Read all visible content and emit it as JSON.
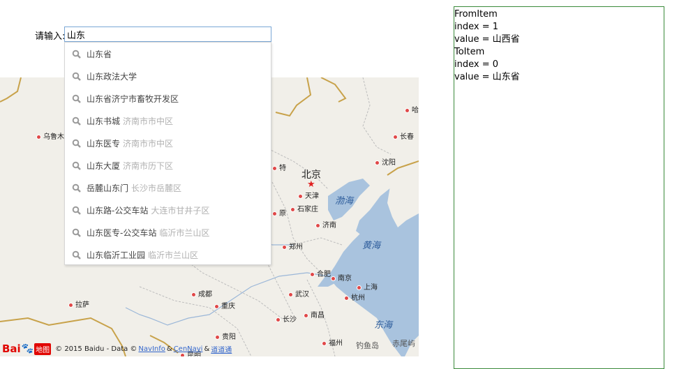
{
  "search": {
    "label": "请输入:",
    "value": "山东"
  },
  "suggestions": [
    {
      "main": "山东省",
      "sub": ""
    },
    {
      "main": "山东政法大学",
      "sub": ""
    },
    {
      "main": "山东省济宁市畜牧开发区",
      "sub": ""
    },
    {
      "main": "山东书城",
      "sub": "济南市市中区"
    },
    {
      "main": "山东医专",
      "sub": "济南市市中区"
    },
    {
      "main": "山东大厦",
      "sub": "济南市历下区"
    },
    {
      "main": "岳麓山东门",
      "sub": "长沙市岳麓区"
    },
    {
      "main": "山东路-公交车站",
      "sub": "大连市甘井子区"
    },
    {
      "main": "山东医专-公交车站",
      "sub": "临沂市兰山区"
    },
    {
      "main": "山东临沂工业园",
      "sub": "临沂市兰山区"
    }
  ],
  "map": {
    "capital": "北京",
    "cities": {
      "haerbin": "哈",
      "urumqi": "乌鲁木",
      "changchun": "长春",
      "shenyang": "沈阳",
      "tianjin": "天津",
      "huhehaote": "特",
      "shijiazhuang": "石家庄",
      "taiyuan": "原",
      "jinan": "济南",
      "zhengzhou": "郑州",
      "hefei": "合肥",
      "nanjing": "南京",
      "shanghai": "上海",
      "chengdu": "成都",
      "wuhan": "武汉",
      "hangzhou": "杭州",
      "lasa": "拉萨",
      "chongqing": "重庆",
      "nanchang": "南昌",
      "changsha": "长沙",
      "guiyang": "贵阳",
      "fuzhou": "福州",
      "kunming": "昆明"
    },
    "seas": {
      "bohai": "渤海",
      "huanghai": "黄海",
      "donghai": "东海"
    },
    "islands": {
      "diaoyudao": "钓鱼岛",
      "chiweiyu": "赤尾屿"
    },
    "copyright": {
      "logo_text": "Bai",
      "logo_paw": "🐾",
      "logo_tag": "地图",
      "text": "© 2015 Baidu - Data ©",
      "link1": "NavInfo",
      "amp1": "&",
      "link2": "CenNavi",
      "amp2": "&",
      "link3": "道道通"
    }
  },
  "log": {
    "lines": [
      "FromItem",
      "index = 1",
      "value = 山西省",
      "ToItem",
      "index = 0",
      "value = 山东省"
    ]
  },
  "colors": {
    "sea": "#a9c3de",
    "land": "#f1efe9",
    "border": "#c8a24a",
    "log_border": "#3a8a3a"
  }
}
